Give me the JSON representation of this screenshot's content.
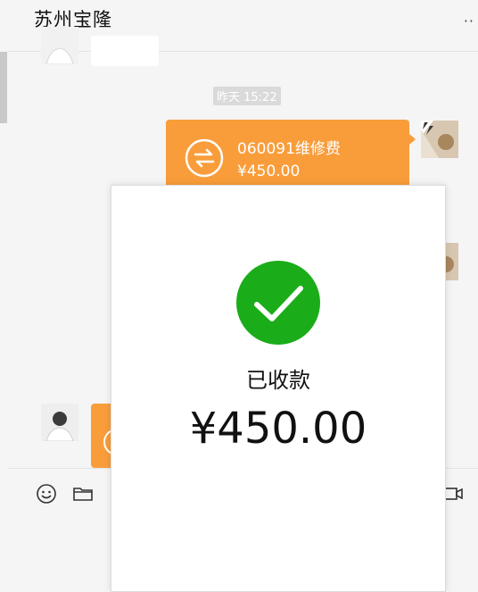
{
  "header": {
    "title": "苏州宝隆",
    "more_label": "··"
  },
  "messages": {
    "timestamp": "昨天 15:22",
    "transfer": {
      "title": "060091维修费",
      "amount": "¥450.00"
    }
  },
  "modal": {
    "status": "已收款",
    "amount": "¥450.00"
  },
  "colors": {
    "transfer_orange": "#f99d3b",
    "success_green": "#1aad19"
  },
  "icons": {
    "emoji": "emoji-icon",
    "folder": "folder-icon",
    "video": "video-call-icon",
    "transfer": "transfer-icon",
    "check": "check-icon"
  }
}
